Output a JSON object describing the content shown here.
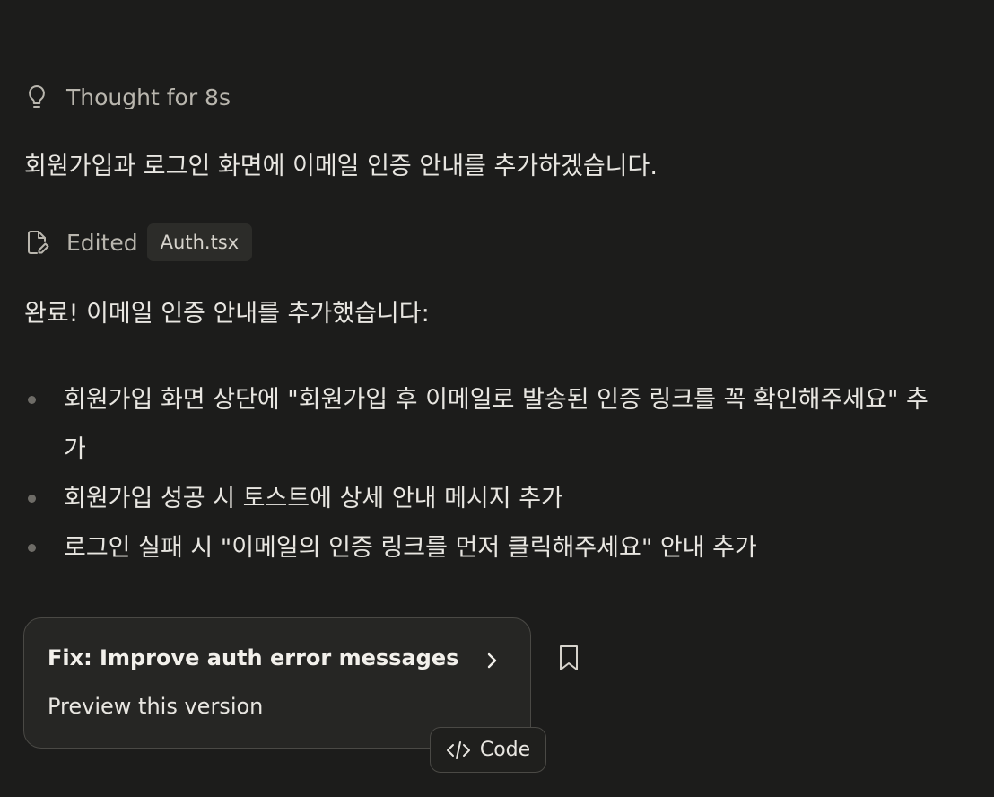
{
  "thought": {
    "icon": "lightbulb-icon",
    "label": "Thought for 8s"
  },
  "message_intro": "회원가입과 로그인 화면에 이메일 인증 안내를 추가하겠습니다.",
  "edit": {
    "icon": "file-edit-icon",
    "label": "Edited",
    "file": "Auth.tsx"
  },
  "message_done": "완료! 이메일 인증 안내를 추가했습니다:",
  "bullets": [
    "회원가입 화면 상단에 \"회원가입 후 이메일로 발송된 인증 링크를 꼭 확인해주세요\" 추가",
    "회원가입 성공 시 토스트에 상세 안내 메시지 추가",
    "로그인 실패 시 \"이메일의 인증 링크를 먼저 클릭해주세요\" 안내 추가"
  ],
  "version_card": {
    "title": "Fix: Improve auth error messages",
    "subtitle": "Preview this version",
    "chevron_icon": "chevron-right-icon"
  },
  "bookmark_icon": "bookmark-icon",
  "code_button": {
    "icon": "code-icon",
    "label": "Code"
  },
  "colors": {
    "background": "#1c1c1b",
    "text": "#e8e6e1",
    "muted_text": "#b9b6ae",
    "card_background": "#262624",
    "border": "#4a4945"
  }
}
